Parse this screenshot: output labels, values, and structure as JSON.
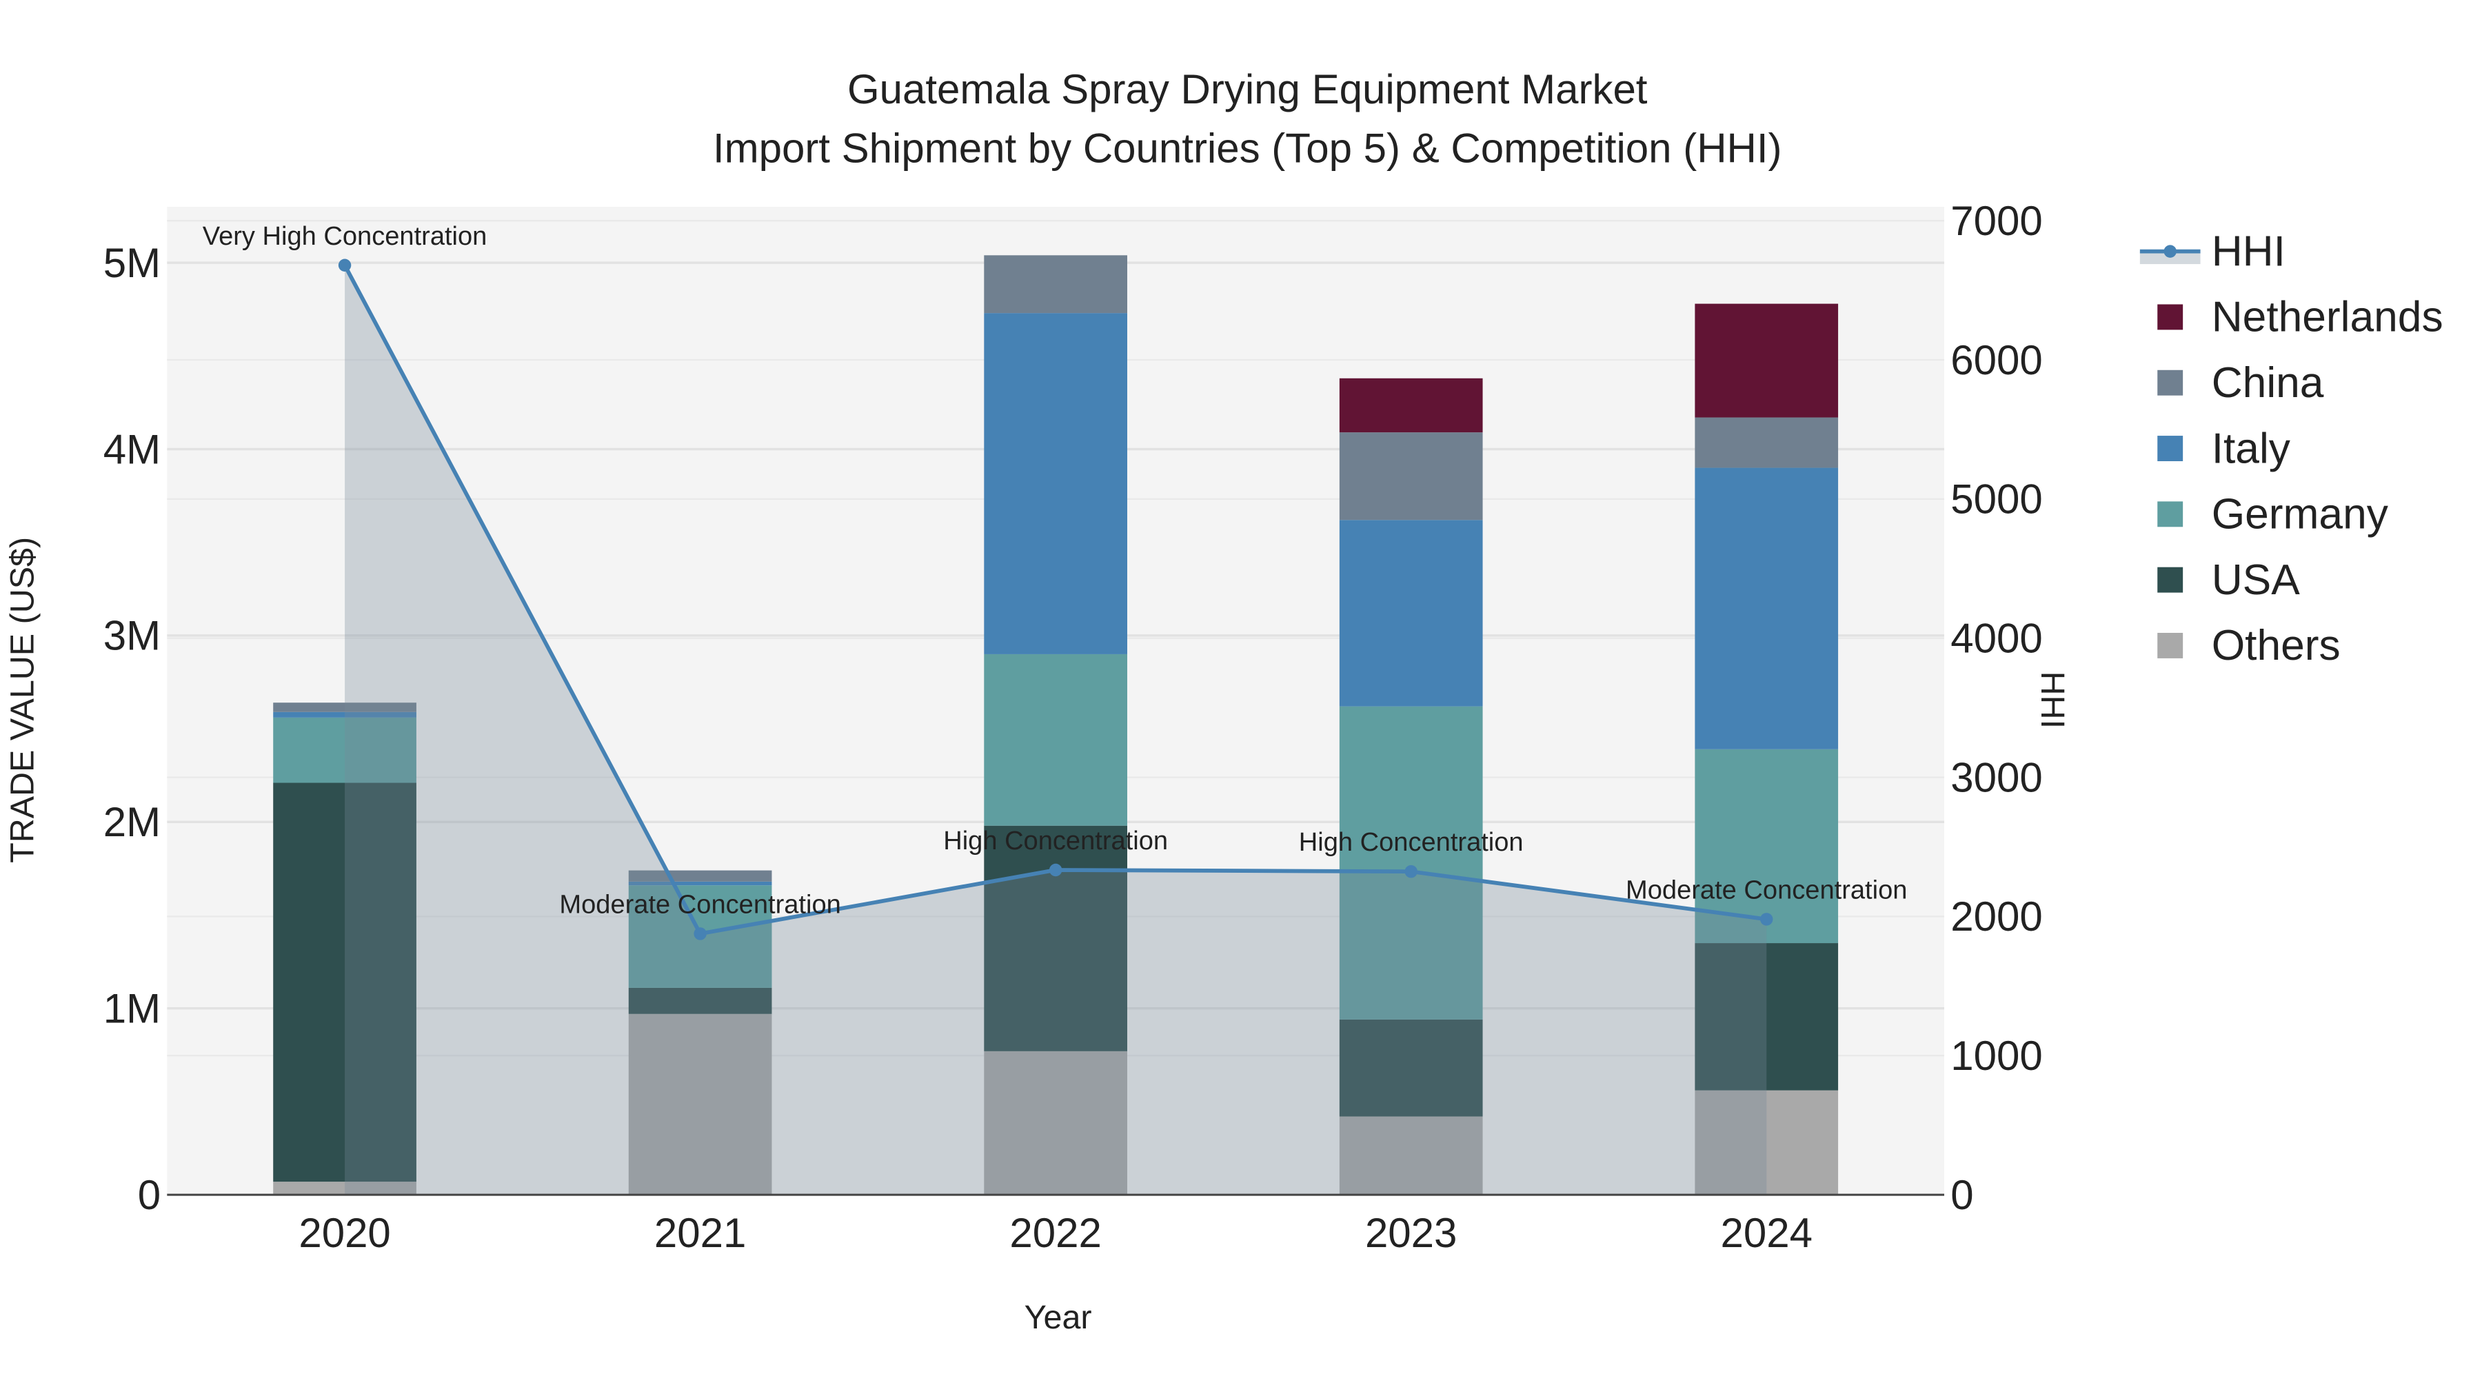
{
  "chart_data": {
    "type": "bar",
    "stacked": true,
    "title_line1": "Guatemala Spray Drying Equipment Market",
    "title_line2": "Import Shipment by Countries (Top 5) & Competition (HHI)",
    "xlabel": "Year",
    "ylabel": "TRADE VALUE (US$)",
    "y2label": "HHI",
    "categories": [
      "2020",
      "2021",
      "2022",
      "2023",
      "2024"
    ],
    "ylim": [
      0,
      5300000
    ],
    "y2lim": [
      0,
      7100
    ],
    "yticks": [
      {
        "v": 0,
        "label": "0"
      },
      {
        "v": 1000000,
        "label": "1M"
      },
      {
        "v": 2000000,
        "label": "2M"
      },
      {
        "v": 3000000,
        "label": "3M"
      },
      {
        "v": 4000000,
        "label": "4M"
      },
      {
        "v": 5000000,
        "label": "5M"
      }
    ],
    "y2ticks": [
      {
        "v": 0,
        "label": "0"
      },
      {
        "v": 1000,
        "label": "1000"
      },
      {
        "v": 2000,
        "label": "2000"
      },
      {
        "v": 3000,
        "label": "3000"
      },
      {
        "v": 4000,
        "label": "4000"
      },
      {
        "v": 5000,
        "label": "5000"
      },
      {
        "v": 6000,
        "label": "6000"
      },
      {
        "v": 7000,
        "label": "7000"
      }
    ],
    "series": [
      {
        "name": "Others",
        "color": "#a9a9a9",
        "values": [
          70000,
          970000,
          770000,
          420000,
          560000
        ]
      },
      {
        "name": "USA",
        "color": "#2f4f4f",
        "values": [
          2140000,
          140000,
          1210000,
          520000,
          790000
        ]
      },
      {
        "name": "Germany",
        "color": "#5f9ea0",
        "values": [
          350000,
          550000,
          920000,
          1680000,
          1040000
        ]
      },
      {
        "name": "Italy",
        "color": "#4682b4",
        "values": [
          30000,
          20000,
          1830000,
          1000000,
          1510000
        ]
      },
      {
        "name": "China",
        "color": "#708090",
        "values": [
          50000,
          60000,
          310000,
          470000,
          270000
        ]
      },
      {
        "name": "Netherlands",
        "color": "#611434",
        "values": [
          0,
          0,
          0,
          290000,
          610000
        ]
      }
    ],
    "hhi": {
      "name": "HHI",
      "color": "#4682b4",
      "values": [
        6680,
        1876,
        2334,
        2323,
        1980
      ],
      "annotations": [
        "Very High Concentration",
        "Moderate Concentration",
        "High Concentration",
        "High Concentration",
        "Moderate Concentration"
      ]
    },
    "legend_order": [
      "HHI",
      "Netherlands",
      "China",
      "Italy",
      "Germany",
      "USA",
      "Others"
    ],
    "legend_position": "right",
    "grid": true
  }
}
